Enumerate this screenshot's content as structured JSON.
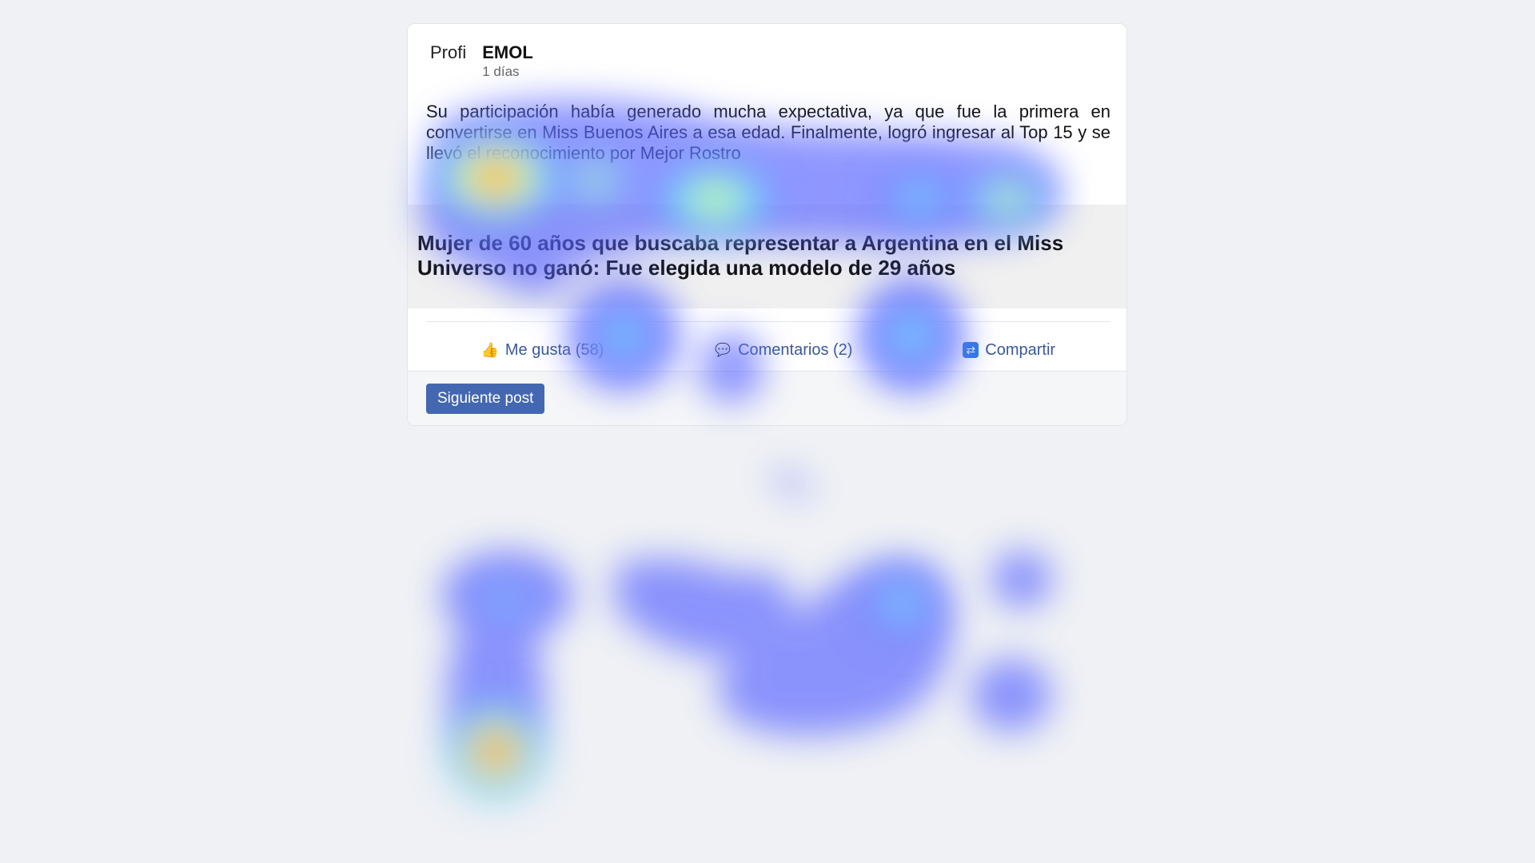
{
  "post": {
    "avatar_alt": "Profi",
    "author": "EMOL",
    "time": "1 días",
    "body": "Su participación había generado mucha expectativa, ya que fue la primera en convertirse en Miss Buenos Aires a esa edad. Finalmente, logró ingresar al Top 15 y se llevó el reconocimiento por Mejor Rostro",
    "link_title": "Mujer de 60 años que buscaba representar a Argentina en el Miss Universo no ganó: Fue elegida una modelo de 29 años"
  },
  "actions": {
    "like": "Me gusta (58)",
    "comments": "Comentarios (2)",
    "share": "Compartir"
  },
  "footer": {
    "next_button": "Siguiente post"
  },
  "icons": {
    "like": "thumbs-up-icon",
    "comments": "speech-bubble-icon",
    "share": "share-arrows-icon"
  },
  "colors": {
    "page_background": "#eff1f5",
    "link_color": "#3b5998",
    "button_background": "#4367b1",
    "heat_low": "#5a66ff",
    "heat_mid": "#6ff0ff",
    "heat_warm": "#ffef5a",
    "heat_hot": "#ff3b2f"
  }
}
